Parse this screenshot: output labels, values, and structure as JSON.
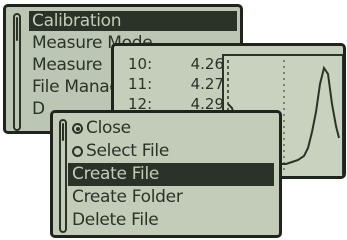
{
  "main_menu": {
    "items": [
      "Calibration",
      "Measure Mode",
      "Measure",
      "File Manager",
      "D"
    ],
    "selected_index": 0
  },
  "data_screen": {
    "readings": [
      {
        "index": "10:",
        "value": "4.26"
      },
      {
        "index": "11:",
        "value": "4.27"
      },
      {
        "index": "12:",
        "value": "4.29"
      }
    ]
  },
  "file_menu": {
    "options": [
      {
        "label": "Close",
        "radio": true,
        "checked": true
      },
      {
        "label": "Select File",
        "radio": true,
        "checked": false
      },
      {
        "label": "Create File",
        "radio": false,
        "highlighted": true
      },
      {
        "label": "Create Folder",
        "radio": false
      },
      {
        "label": "Delete File",
        "radio": false
      }
    ]
  },
  "colors": {
    "lcd_background": "#bcc6b4",
    "lcd_ink": "#2b3328",
    "bezel": "#1f251d"
  }
}
